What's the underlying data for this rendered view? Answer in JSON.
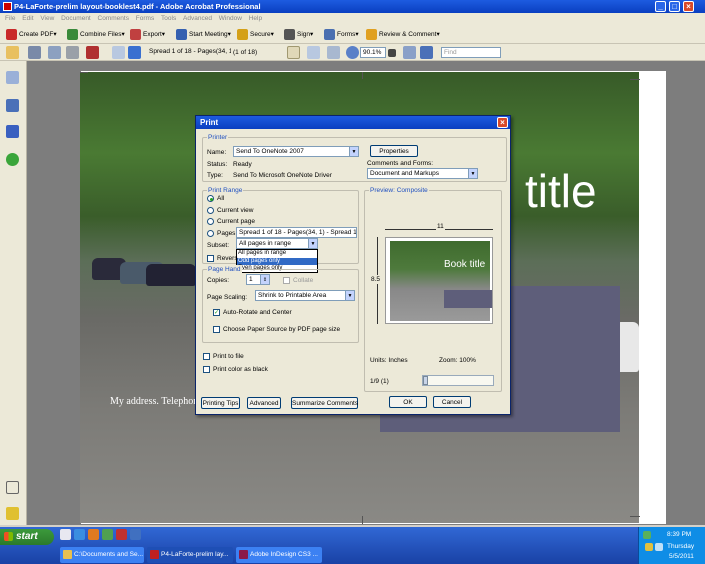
{
  "window": {
    "title": "P4-LaForte-prelim layout-booklest4.pdf - Adobe Acrobat Professional"
  },
  "menu": [
    "File",
    "Edit",
    "View",
    "Document",
    "Comments",
    "Forms",
    "Tools",
    "Advanced",
    "Window",
    "Help"
  ],
  "toolbar1": {
    "create_pdf": "Create PDF",
    "combine": "Combine Files",
    "export": "Export",
    "start_meeting": "Start Meeting",
    "secure": "Secure",
    "sign": "Sign",
    "forms": "Forms",
    "review": "Review & Comment"
  },
  "toolbar2": {
    "page_field": "Spread 1 of 18 - Pages(34, 1)",
    "page_count": "(1 of 18)",
    "zoom": "90.1%",
    "find_placeholder": "Find"
  },
  "document": {
    "title_text": "title",
    "address_text": "My address. Telephone"
  },
  "print_dialog": {
    "title": "Print",
    "printer_group": "Printer",
    "name_label": "Name:",
    "name_value": "Send To OneNote 2007",
    "status_label": "Status:",
    "status_value": "Ready",
    "type_label": "Type:",
    "type_value": "Send To Microsoft OneNote Driver",
    "properties_button": "Properties",
    "comments_forms_label": "Comments and Forms:",
    "comments_forms_value": "Document and Markups",
    "range_group": "Print Range",
    "radio_all": "All",
    "radio_current_view": "Current view",
    "radio_current_page": "Current page",
    "radio_pages": "Pages",
    "pages_value": "Spread 1 of 18 - Pages(34, 1) - Spread 18 of 1",
    "subset_label": "Subset:",
    "subset_value": "All pages in range",
    "subset_options": [
      "All pages in range",
      "Odd pages only",
      "Even pages only"
    ],
    "subset_selected": "Odd pages only",
    "reverse_label": "Revers",
    "handling_group": "Page Hand",
    "copies_label": "Copies:",
    "copies_value": "1",
    "collate_label": "Collate",
    "scaling_label": "Page Scaling:",
    "scaling_value": "Shrink to Printable Area",
    "auto_rotate_label": "Auto-Rotate and Center",
    "paper_source_label": "Choose Paper Source by PDF page size",
    "print_to_file": "Print to file",
    "print_color_black": "Print color as black",
    "preview_group": "Preview: Composite",
    "preview_width": "11",
    "preview_height": "8.5",
    "preview_title": "Book title",
    "units_label": "Units: Inches",
    "zoom_label": "Zoom: 100%",
    "page_indicator": "1/9 (1)",
    "tips_button": "Printing Tips",
    "advanced_button": "Advanced",
    "summarize_button": "Summarize Comments",
    "ok_button": "OK",
    "cancel_button": "Cancel"
  },
  "taskbar": {
    "start": "start",
    "tasks": [
      "C:\\Documents and Se...",
      "P4-LaForte-prelim lay...",
      "Adobe InDesign CS3 ..."
    ],
    "clock_time": "8:39 PM",
    "clock_day": "Thursday",
    "clock_date": "5/5/2011"
  },
  "colors": {
    "title_bar": "#0a3fc0",
    "purple_box": "#5e5e7a",
    "taskbar": "#245edb"
  }
}
